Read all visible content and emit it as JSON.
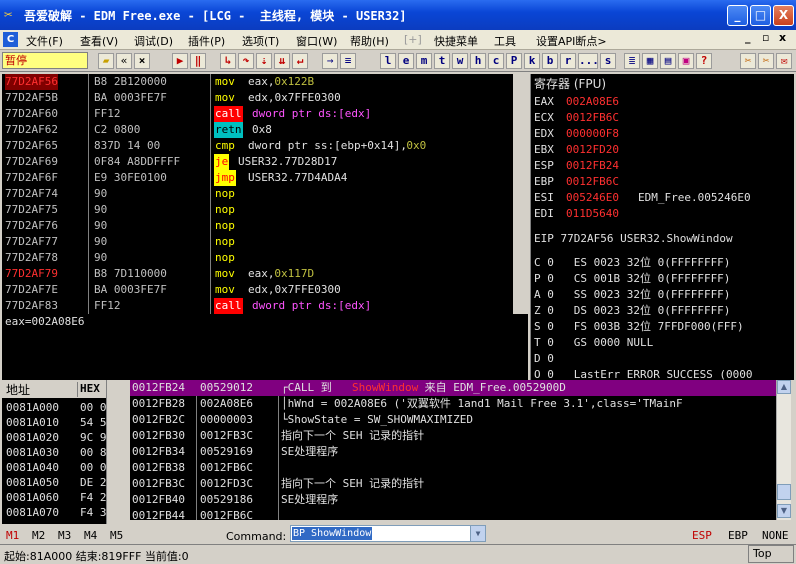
{
  "window": {
    "title": "吾爱破解 - EDM Free.exe - [LCG -  主线程, 模块 - USER32]",
    "minimize": "_",
    "maximize": "□",
    "close": "X"
  },
  "menu": [
    "文件(F)",
    "查看(V)",
    "调试(D)",
    "插件(P)",
    "选项(T)",
    "窗口(W)",
    "帮助(H)",
    "[+]",
    "快捷菜单",
    "工具",
    "设置API断点>"
  ],
  "toolbar": {
    "status": "暂停",
    "letters": [
      "l",
      "e",
      "m",
      "t",
      "w",
      "h",
      "c",
      "P",
      "k",
      "b",
      "r",
      "...",
      "s"
    ]
  },
  "disasm": {
    "rows": [
      {
        "addr": "77D2AF56",
        "hex": "B8 2B120000",
        "mn": "mov",
        "op": "eax,",
        "op2": "0x122B",
        "current": true
      },
      {
        "addr": "77D2AF5B",
        "hex": "BA 0003FE7F",
        "mn": "mov",
        "op": "edx,0x7FFE0300",
        "op2": ""
      },
      {
        "addr": "77D2AF60",
        "hex": "FF12",
        "mn": "call",
        "op": "dword ptr ds:[edx]",
        "op2": ""
      },
      {
        "addr": "77D2AF62",
        "hex": "C2 0800",
        "mn": "retn",
        "op": "0x8",
        "op2": ""
      },
      {
        "addr": "77D2AF65",
        "hex": "837D 14 00",
        "mn": "cmp",
        "op": "dword ptr ss:[ebp+0x14],",
        "op2": "0x0"
      },
      {
        "addr": "77D2AF69",
        "hex": "0F84 A8DDFFFF",
        "mn": "je",
        "op": "USER32.77D28D17",
        "op2": ""
      },
      {
        "addr": "77D2AF6F",
        "hex": "E9 30FE0100",
        "mn": "jmp",
        "op": "USER32.77D4ADA4",
        "op2": ""
      },
      {
        "addr": "77D2AF74",
        "hex": "90",
        "mn": "nop",
        "op": "",
        "op2": ""
      },
      {
        "addr": "77D2AF75",
        "hex": "90",
        "mn": "nop",
        "op": "",
        "op2": ""
      },
      {
        "addr": "77D2AF76",
        "hex": "90",
        "mn": "nop",
        "op": "",
        "op2": ""
      },
      {
        "addr": "77D2AF77",
        "hex": "90",
        "mn": "nop",
        "op": "",
        "op2": ""
      },
      {
        "addr": "77D2AF78",
        "hex": "90",
        "mn": "nop",
        "op": "",
        "op2": ""
      },
      {
        "addr": "77D2AF79",
        "hex": "B8 7D110000",
        "mn": "mov",
        "op": "eax,",
        "op2": "0x117D"
      },
      {
        "addr": "77D2AF7E",
        "hex": "BA 0003FE7F",
        "mn": "mov",
        "op": "edx,0x7FFE0300",
        "op2": ""
      },
      {
        "addr": "77D2AF83",
        "hex": "FF12",
        "mn": "call",
        "op": "dword ptr ds:[edx]",
        "op2": ""
      }
    ]
  },
  "info_text": "eax=002A08E6",
  "registers": {
    "header": "寄存器 (FPU)",
    "gp": [
      {
        "name": "EAX",
        "val": "002A08E6",
        "extra": ""
      },
      {
        "name": "ECX",
        "val": "0012FB6C",
        "extra": ""
      },
      {
        "name": "EDX",
        "val": "000000F8",
        "extra": ""
      },
      {
        "name": "EBX",
        "val": "0012FD20",
        "extra": ""
      },
      {
        "name": "ESP",
        "val": "0012FB24",
        "extra": ""
      },
      {
        "name": "EBP",
        "val": "0012FB6C",
        "extra": ""
      },
      {
        "name": "ESI",
        "val": "005246E0",
        "extra": "EDM_Free.005246E0"
      },
      {
        "name": "EDI",
        "val": "011D5640",
        "extra": ""
      }
    ],
    "eip": "EIP 77D2AF56 USER32.ShowWindow",
    "segs": [
      "C 0   ES 0023 32位 0(FFFFFFFF)",
      "P 0   CS 001B 32位 0(FFFFFFFF)",
      "A 0   SS 0023 32位 0(FFFFFFFF)",
      "Z 0   DS 0023 32位 0(FFFFFFFF)",
      "S 0   FS 003B 32位 7FFDF000(FFF)",
      "T 0   GS 0000 NULL",
      "D 0",
      "O 0   LastErr ERROR_SUCCESS (0000"
    ]
  },
  "dump": {
    "col_addr": "地址",
    "col_hex": "HEX",
    "rows": [
      {
        "addr": "0081A000",
        "hex": "00 0"
      },
      {
        "addr": "0081A010",
        "hex": "54 5"
      },
      {
        "addr": "0081A020",
        "hex": "9C 9"
      },
      {
        "addr": "0081A030",
        "hex": "00 8"
      },
      {
        "addr": "0081A040",
        "hex": "00 0"
      },
      {
        "addr": "0081A050",
        "hex": "DE 2"
      },
      {
        "addr": "0081A060",
        "hex": "F4 2"
      },
      {
        "addr": "0081A070",
        "hex": "F4 3"
      }
    ]
  },
  "stack": {
    "rows": [
      {
        "addr": "0012FB24",
        "val": "00529012",
        "c1": "┌CALL 到 ",
        "c2": "ShowWindow",
        "c3": " 来自 EDM_Free.0052900D",
        "selected": true
      },
      {
        "addr": "0012FB28",
        "val": "002A08E6",
        "c1": "│hWnd = 002A08E6 ('双翼软件 1and1 Mail Free 3.1',class='TMainF",
        "c2": "",
        "c3": ""
      },
      {
        "addr": "0012FB2C",
        "val": "00000003",
        "c1": "└ShowState = SW_SHOWMAXIMIZED",
        "c2": "",
        "c3": ""
      },
      {
        "addr": "0012FB30",
        "val": "0012FB3C",
        "c1": "指向下一个 SEH 记录的指针",
        "c2": "",
        "c3": ""
      },
      {
        "addr": "0012FB34",
        "val": "00529169",
        "c1": "SE处理程序",
        "c2": "",
        "c3": ""
      },
      {
        "addr": "0012FB38",
        "val": "0012FB6C",
        "c1": "",
        "c2": "",
        "c3": ""
      },
      {
        "addr": "0012FB3C",
        "val": "0012FD3C",
        "c1": "指向下一个 SEH 记录的指针",
        "c2": "",
        "c3": ""
      },
      {
        "addr": "0012FB40",
        "val": "00529186",
        "c1": "SE处理程序",
        "c2": "",
        "c3": ""
      },
      {
        "addr": "0012FB44",
        "val": "0012FB6C",
        "c1": "",
        "c2": "",
        "c3": ""
      }
    ]
  },
  "cmdbar": {
    "tabs": [
      "M1",
      "M2",
      "M3",
      "M4",
      "M5"
    ],
    "label": "Command:",
    "value": "BP ShowWindow",
    "regs": [
      "ESP",
      "EBP",
      "NONE"
    ]
  },
  "statusbar": {
    "text": "起始:81A000 结束:819FFF 当前值:0",
    "right": "Top"
  },
  "colors": {
    "title": "#0a46d6",
    "panel_bg": "#000000",
    "selection": "#800080",
    "highlight_red": "#ff3030"
  }
}
